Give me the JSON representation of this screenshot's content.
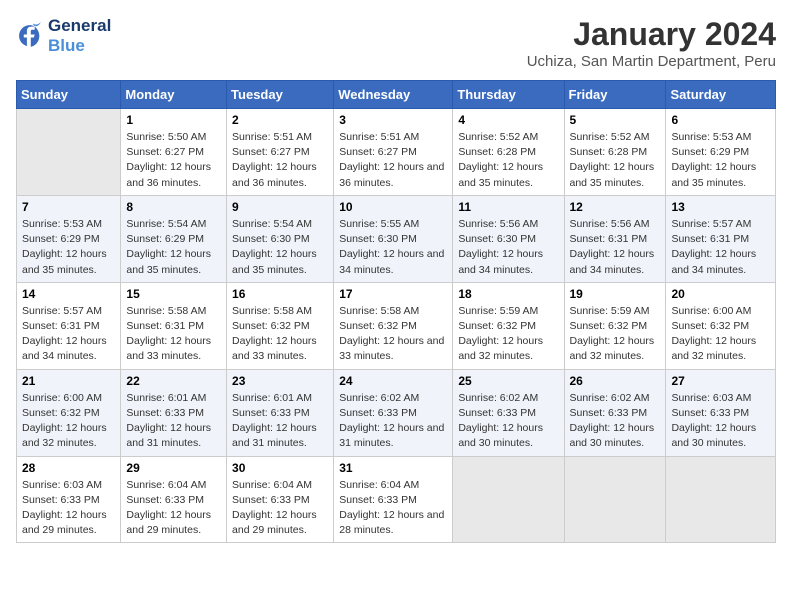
{
  "logo": {
    "line1": "General",
    "line2": "Blue"
  },
  "title": "January 2024",
  "subtitle": "Uchiza, San Martin Department, Peru",
  "days_header": [
    "Sunday",
    "Monday",
    "Tuesday",
    "Wednesday",
    "Thursday",
    "Friday",
    "Saturday"
  ],
  "weeks": [
    [
      {
        "day": "",
        "info": ""
      },
      {
        "day": "1",
        "info": "Sunrise: 5:50 AM\nSunset: 6:27 PM\nDaylight: 12 hours and 36 minutes."
      },
      {
        "day": "2",
        "info": "Sunrise: 5:51 AM\nSunset: 6:27 PM\nDaylight: 12 hours and 36 minutes."
      },
      {
        "day": "3",
        "info": "Sunrise: 5:51 AM\nSunset: 6:27 PM\nDaylight: 12 hours and 36 minutes."
      },
      {
        "day": "4",
        "info": "Sunrise: 5:52 AM\nSunset: 6:28 PM\nDaylight: 12 hours and 35 minutes."
      },
      {
        "day": "5",
        "info": "Sunrise: 5:52 AM\nSunset: 6:28 PM\nDaylight: 12 hours and 35 minutes."
      },
      {
        "day": "6",
        "info": "Sunrise: 5:53 AM\nSunset: 6:29 PM\nDaylight: 12 hours and 35 minutes."
      }
    ],
    [
      {
        "day": "7",
        "info": "Sunrise: 5:53 AM\nSunset: 6:29 PM\nDaylight: 12 hours and 35 minutes."
      },
      {
        "day": "8",
        "info": "Sunrise: 5:54 AM\nSunset: 6:29 PM\nDaylight: 12 hours and 35 minutes."
      },
      {
        "day": "9",
        "info": "Sunrise: 5:54 AM\nSunset: 6:30 PM\nDaylight: 12 hours and 35 minutes."
      },
      {
        "day": "10",
        "info": "Sunrise: 5:55 AM\nSunset: 6:30 PM\nDaylight: 12 hours and 34 minutes."
      },
      {
        "day": "11",
        "info": "Sunrise: 5:56 AM\nSunset: 6:30 PM\nDaylight: 12 hours and 34 minutes."
      },
      {
        "day": "12",
        "info": "Sunrise: 5:56 AM\nSunset: 6:31 PM\nDaylight: 12 hours and 34 minutes."
      },
      {
        "day": "13",
        "info": "Sunrise: 5:57 AM\nSunset: 6:31 PM\nDaylight: 12 hours and 34 minutes."
      }
    ],
    [
      {
        "day": "14",
        "info": "Sunrise: 5:57 AM\nSunset: 6:31 PM\nDaylight: 12 hours and 34 minutes."
      },
      {
        "day": "15",
        "info": "Sunrise: 5:58 AM\nSunset: 6:31 PM\nDaylight: 12 hours and 33 minutes."
      },
      {
        "day": "16",
        "info": "Sunrise: 5:58 AM\nSunset: 6:32 PM\nDaylight: 12 hours and 33 minutes."
      },
      {
        "day": "17",
        "info": "Sunrise: 5:58 AM\nSunset: 6:32 PM\nDaylight: 12 hours and 33 minutes."
      },
      {
        "day": "18",
        "info": "Sunrise: 5:59 AM\nSunset: 6:32 PM\nDaylight: 12 hours and 32 minutes."
      },
      {
        "day": "19",
        "info": "Sunrise: 5:59 AM\nSunset: 6:32 PM\nDaylight: 12 hours and 32 minutes."
      },
      {
        "day": "20",
        "info": "Sunrise: 6:00 AM\nSunset: 6:32 PM\nDaylight: 12 hours and 32 minutes."
      }
    ],
    [
      {
        "day": "21",
        "info": "Sunrise: 6:00 AM\nSunset: 6:32 PM\nDaylight: 12 hours and 32 minutes."
      },
      {
        "day": "22",
        "info": "Sunrise: 6:01 AM\nSunset: 6:33 PM\nDaylight: 12 hours and 31 minutes."
      },
      {
        "day": "23",
        "info": "Sunrise: 6:01 AM\nSunset: 6:33 PM\nDaylight: 12 hours and 31 minutes."
      },
      {
        "day": "24",
        "info": "Sunrise: 6:02 AM\nSunset: 6:33 PM\nDaylight: 12 hours and 31 minutes."
      },
      {
        "day": "25",
        "info": "Sunrise: 6:02 AM\nSunset: 6:33 PM\nDaylight: 12 hours and 30 minutes."
      },
      {
        "day": "26",
        "info": "Sunrise: 6:02 AM\nSunset: 6:33 PM\nDaylight: 12 hours and 30 minutes."
      },
      {
        "day": "27",
        "info": "Sunrise: 6:03 AM\nSunset: 6:33 PM\nDaylight: 12 hours and 30 minutes."
      }
    ],
    [
      {
        "day": "28",
        "info": "Sunrise: 6:03 AM\nSunset: 6:33 PM\nDaylight: 12 hours and 29 minutes."
      },
      {
        "day": "29",
        "info": "Sunrise: 6:04 AM\nSunset: 6:33 PM\nDaylight: 12 hours and 29 minutes."
      },
      {
        "day": "30",
        "info": "Sunrise: 6:04 AM\nSunset: 6:33 PM\nDaylight: 12 hours and 29 minutes."
      },
      {
        "day": "31",
        "info": "Sunrise: 6:04 AM\nSunset: 6:33 PM\nDaylight: 12 hours and 28 minutes."
      },
      {
        "day": "",
        "info": ""
      },
      {
        "day": "",
        "info": ""
      },
      {
        "day": "",
        "info": ""
      }
    ]
  ]
}
